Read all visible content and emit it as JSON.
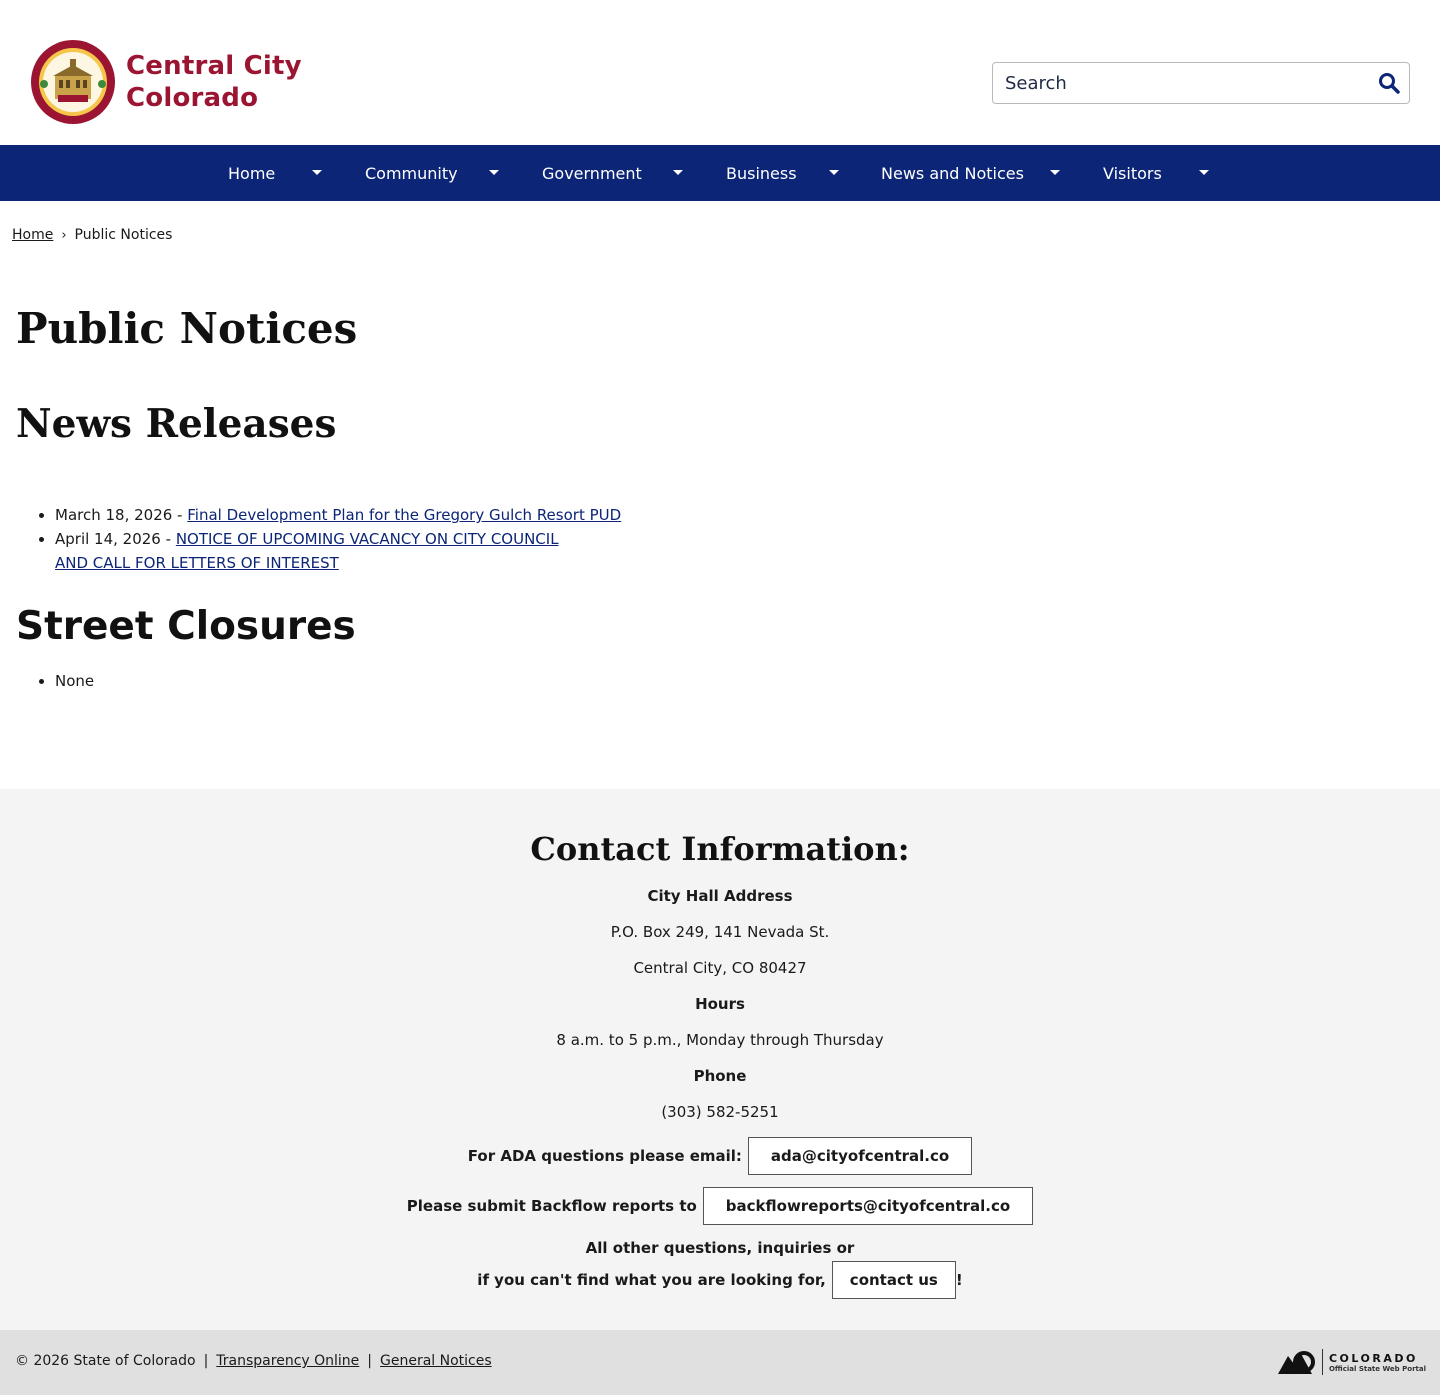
{
  "header": {
    "logo_line1": "Central City",
    "logo_line2": "Colorado",
    "search_placeholder": "Search"
  },
  "nav": {
    "items": [
      {
        "label": "Home"
      },
      {
        "label": "Community"
      },
      {
        "label": "Government"
      },
      {
        "label": "Business"
      },
      {
        "label": "News and Notices"
      },
      {
        "label": "Visitors"
      }
    ]
  },
  "breadcrumb": {
    "home": "Home",
    "separator": "›",
    "current": "Public Notices"
  },
  "main": {
    "title": "Public Notices",
    "news_heading": "News Releases",
    "news": [
      {
        "date": "March 18, 2026 - ",
        "link": "Final Development Plan for the Gregory Gulch Resort PUD"
      },
      {
        "date": "April 14, 2026 - ",
        "link_line1": "NOTICE OF UPCOMING VACANCY ON CITY COUNCIL",
        "link_line2": "AND CALL FOR LETTERS OF INTEREST"
      }
    ],
    "closures_heading": "Street Closures",
    "closures": [
      "None"
    ]
  },
  "contact": {
    "title": "Contact Information:",
    "address_label": "City Hall Address",
    "address_line1": "P.O. Box 249, 141 Nevada St.",
    "address_line2": "Central City, CO 80427",
    "hours_label": "Hours",
    "hours": "8 a.m. to 5 p.m., Monday through Thursday",
    "phone_label": "Phone",
    "phone": "(303) 582-5251",
    "ada_label": "For ADA questions please email:",
    "ada_email": "ada@cityofcentral.co",
    "backflow_label": "Please submit Backflow reports to",
    "backflow_email": "backflowreports@cityofcentral.co",
    "other_line1": "All other questions, inquiries or",
    "other_line2": "if you can't find what you are looking for,",
    "contact_button": "contact us",
    "exclaim": "!"
  },
  "footer": {
    "copyright": "© 2026 State of Colorado",
    "sep": "|",
    "transparency": "Transparency Online",
    "general": "General Notices",
    "co_logo_big": "COLORADO",
    "co_logo_small": "Official State Web Portal"
  },
  "colors": {
    "nav_bg": "#0c2577",
    "brand_red": "#9b1532",
    "contact_bg": "#f4f4f4",
    "footer_bg": "#e0e0e0"
  }
}
